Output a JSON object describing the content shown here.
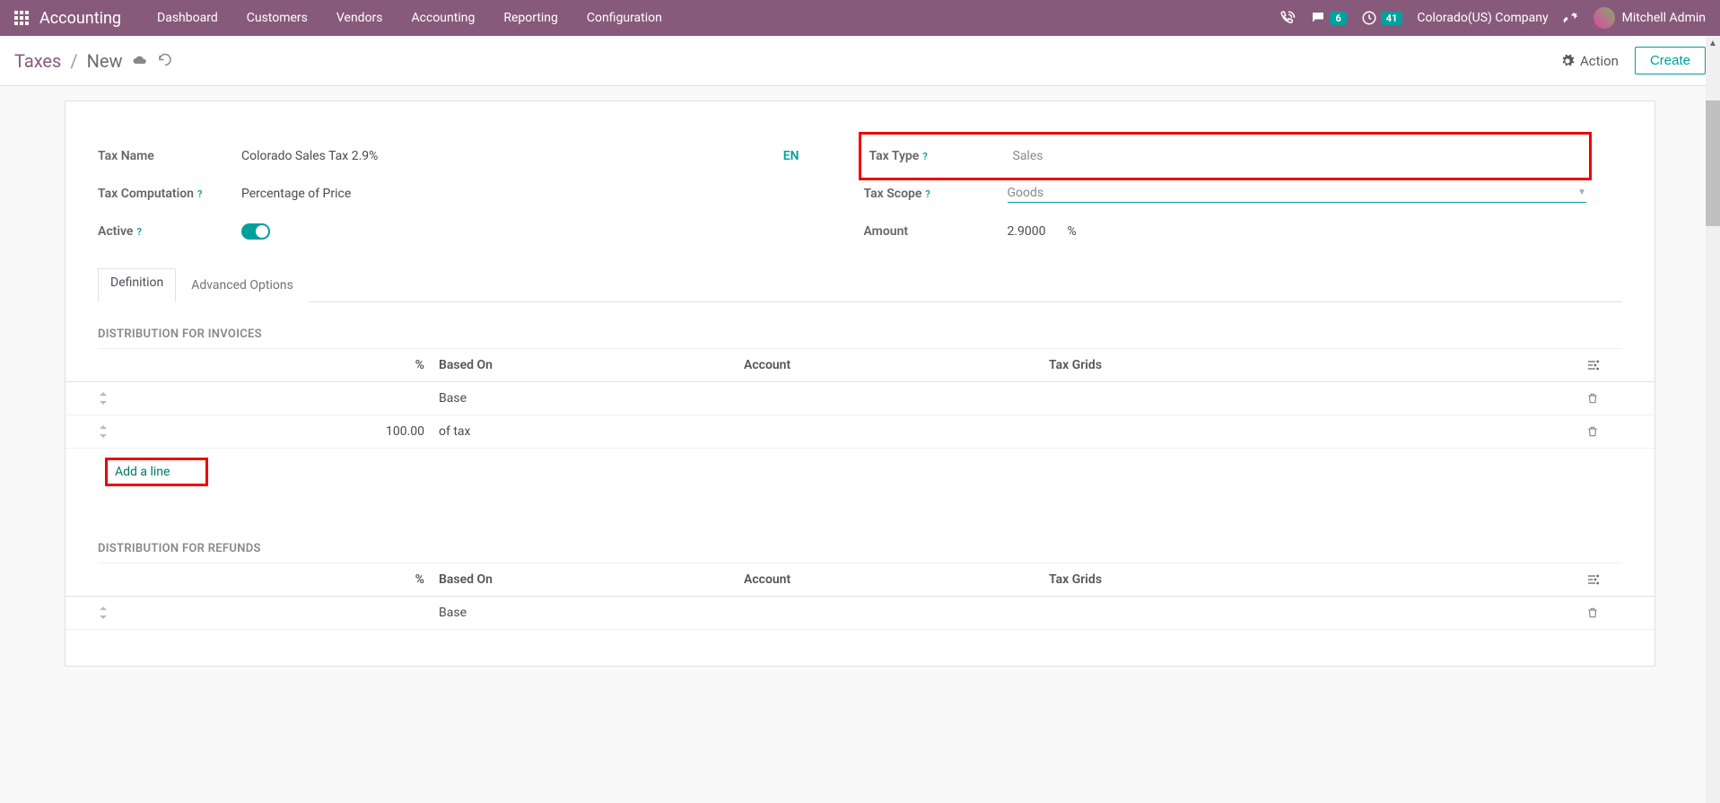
{
  "nav": {
    "app_title": "Accounting",
    "items": [
      "Dashboard",
      "Customers",
      "Vendors",
      "Accounting",
      "Reporting",
      "Configuration"
    ],
    "msg_count": "6",
    "clock_count": "41",
    "company": "Colorado(US) Company",
    "user": "Mitchell Admin"
  },
  "breadcrumb": {
    "root": "Taxes",
    "current": "New",
    "action_label": "Action",
    "create_label": "Create"
  },
  "form": {
    "tax_name_label": "Tax Name",
    "tax_name_value": "Colorado Sales Tax 2.9%",
    "lang": "EN",
    "tax_comp_label": "Tax Computation",
    "tax_comp_value": "Percentage of Price",
    "active_label": "Active",
    "tax_type_label": "Tax Type",
    "tax_type_value": "Sales",
    "tax_scope_label": "Tax Scope",
    "tax_scope_value": "Goods",
    "amount_label": "Amount",
    "amount_value": "2.9000",
    "amount_unit": "%"
  },
  "tabs": {
    "definition": "Definition",
    "advanced": "Advanced Options"
  },
  "dist_invoices": {
    "title": "DISTRIBUTION FOR INVOICES",
    "columns": {
      "pct": "%",
      "based": "Based On",
      "account": "Account",
      "grids": "Tax Grids"
    },
    "rows": [
      {
        "pct": "",
        "based": "Base"
      },
      {
        "pct": "100.00",
        "based": "of tax"
      }
    ],
    "add_line": "Add a line"
  },
  "dist_refunds": {
    "title": "DISTRIBUTION FOR REFUNDS",
    "columns": {
      "pct": "%",
      "based": "Based On",
      "account": "Account",
      "grids": "Tax Grids"
    },
    "rows": [
      {
        "pct": "",
        "based": "Base"
      }
    ]
  }
}
